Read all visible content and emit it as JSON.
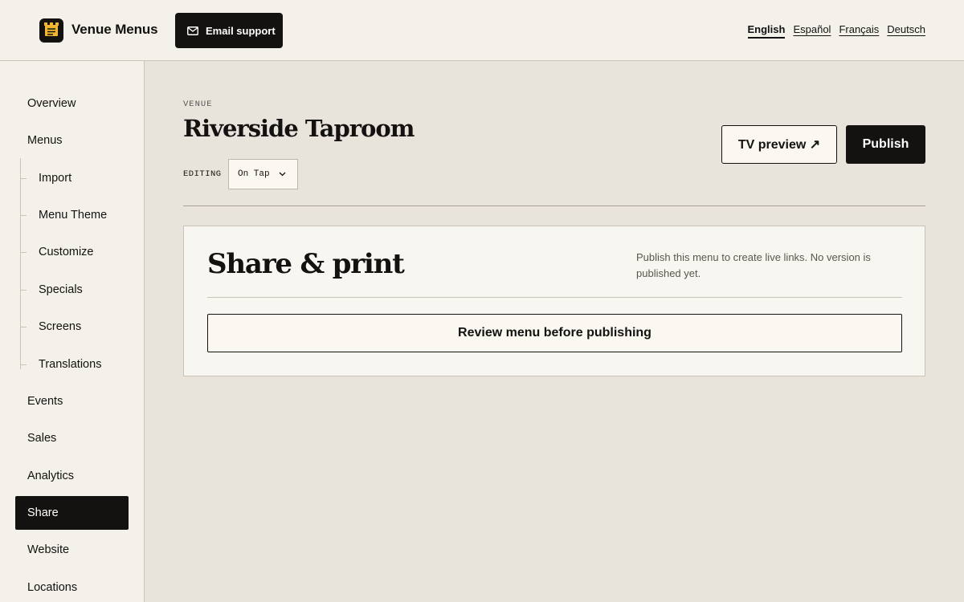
{
  "app": {
    "name": "Venue Menus",
    "logo_icon": "menu-board-icon"
  },
  "header": {
    "email_support_label": "Email support",
    "email_icon": "mail-icon",
    "languages": [
      "English",
      "Español",
      "Français",
      "Deutsch"
    ],
    "active_language": "English"
  },
  "sidebar": {
    "items": [
      {
        "label": "Overview"
      },
      {
        "label": "Menus"
      },
      {
        "label": "Import"
      },
      {
        "label": "Menu Theme"
      },
      {
        "label": "Customize"
      },
      {
        "label": "Specials"
      },
      {
        "label": "Screens"
      },
      {
        "label": "Translations"
      },
      {
        "label": "Events"
      },
      {
        "label": "Sales"
      },
      {
        "label": "Analytics"
      },
      {
        "label": "Share"
      },
      {
        "label": "Website"
      },
      {
        "label": "Locations"
      }
    ],
    "active_item": "Share"
  },
  "main": {
    "eyebrow": "VENUE",
    "title": "Riverside Taproom",
    "editing_label": "EDITING",
    "menu_select_value": "On Tap",
    "tv_preview_label": "TV preview ↗",
    "publish_label": "Publish",
    "card": {
      "title": "Share & print",
      "description": "Publish this menu to create live links. No version is published yet.",
      "review_button_label": "Review menu before publishing"
    }
  },
  "colors": {
    "ink": "#141210",
    "panel": "#f4f1ea",
    "canvas": "#e8e4dc",
    "logo_accent": "#f2b630"
  }
}
